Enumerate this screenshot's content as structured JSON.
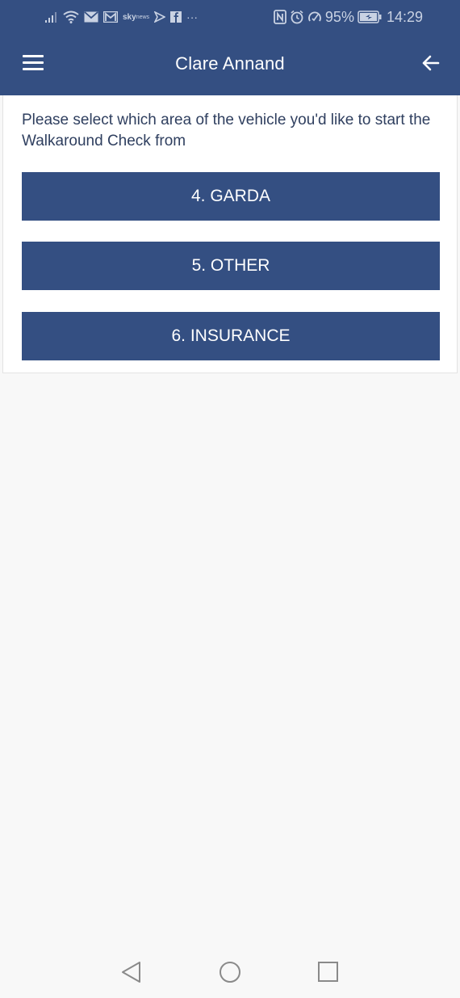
{
  "status_bar": {
    "left_icons": [
      "signal-icon",
      "wifi-icon",
      "mail-icon",
      "gmail-icon",
      "sky-news-icon",
      "play-store-icon",
      "facebook-icon",
      "more-dots-icon"
    ],
    "sky_text": "sky",
    "sky_sub": "news",
    "more": "···",
    "battery_percent": "95%",
    "time": "14:29"
  },
  "app_bar": {
    "title": "Clare Annand",
    "menu_icon": "hamburger-menu-icon",
    "back_icon": "arrow-left-icon"
  },
  "main": {
    "prompt": "Please select which area of the vehicle you'd like to start the Walkaround Check from",
    "areas": [
      {
        "label": "4. GARDA"
      },
      {
        "label": "5. OTHER"
      },
      {
        "label": "6. INSURANCE"
      }
    ]
  },
  "nav_bar": {
    "buttons": [
      "back-triangle-icon",
      "home-circle-icon",
      "recents-square-icon"
    ]
  },
  "colors": {
    "primary": "#344f82",
    "background": "#f8f8f8",
    "card": "#ffffff",
    "text": "#2f3f5f"
  }
}
